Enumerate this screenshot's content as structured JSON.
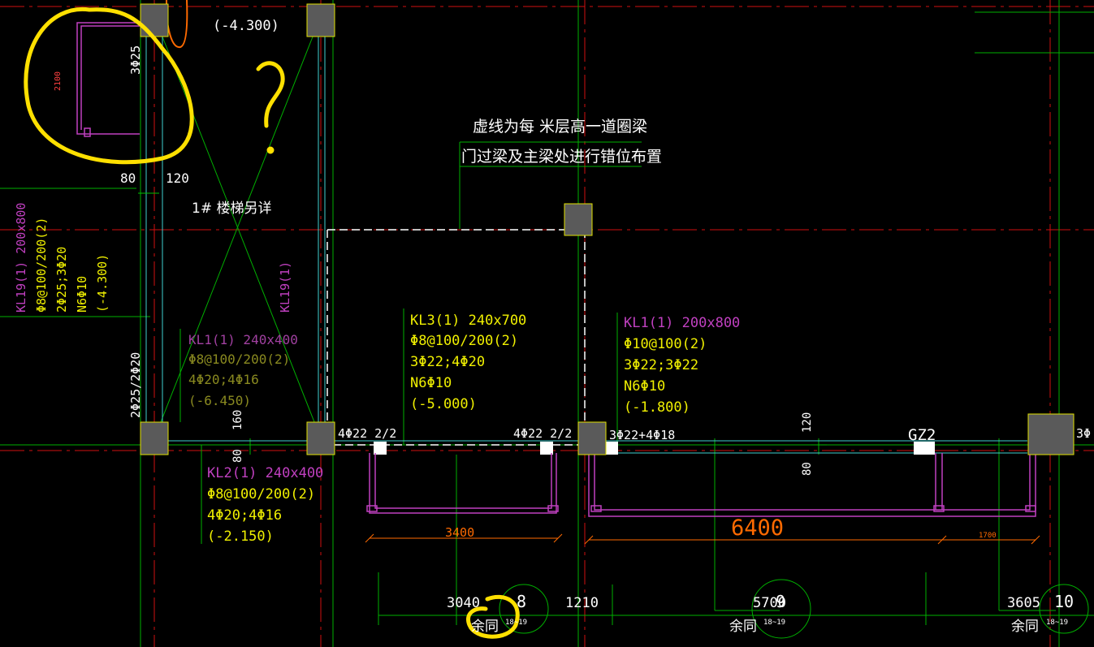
{
  "colors": {
    "background": "#000000",
    "axis_red": "#d01010",
    "green": "#00c000",
    "cyan": "#40d0d0",
    "white": "#ffffff",
    "yellow": "#f0f000",
    "magenta": "#c040c0",
    "olive": "#8a8a20",
    "orange": "#ff6a00",
    "highlight_yellow": "#ffe000",
    "column_fill": "#5a5a5a"
  },
  "top_labels": {
    "elevation_top": "(-4.300)",
    "rebar_3phi25": "3Φ25",
    "dim_2100": "2100",
    "dim_80_top": "80",
    "dim_120_top": "120",
    "question_mark": "?"
  },
  "notes": {
    "line1": "虚线为每  米层高一道圈梁",
    "line2": "门过梁及主梁处进行错位布置",
    "stair": "1# 楼梯另详"
  },
  "beams": {
    "kl19_left": [
      "KL19(1) 200x800",
      "Φ8@100/200(2)",
      "2Φ25;3Φ20",
      "N6Φ10",
      "(-4.300)"
    ],
    "kl19_mid": "KL19(1)",
    "rebar_2phi25": "2Φ25/2Φ20",
    "kl1_olive": [
      "KL1(1) 240x400",
      "Φ8@100/200(2)",
      "4Φ20;4Φ16",
      "(-6.450)"
    ],
    "kl3": [
      "KL3(1) 240x700",
      "Φ8@100/200(2)",
      "3Φ22;4Φ20",
      "N6Φ10",
      "(-5.000)"
    ],
    "kl1_right": [
      "KL1(1) 200x800",
      "Φ10@100(2)",
      "3Φ22;3Φ22",
      "N6Φ10",
      "(-1.800)"
    ],
    "kl2": [
      "KL2(1) 240x400",
      "Φ8@100/200(2)",
      "4Φ20;4Φ16",
      "(-2.150)"
    ]
  },
  "rebar_labels": {
    "a": "4Φ22 2/2",
    "b": "4Φ22 2/2",
    "c": "3Φ22+4Φ18",
    "d": "3Φ"
  },
  "dims": {
    "d160": "160",
    "d80_mid": "80",
    "d120_right": "120",
    "d80_right": "80",
    "gz2": "GZ2",
    "d3400": "3400",
    "d6400": "6400",
    "d1700": "1700"
  },
  "bottom": {
    "d3040": "3040",
    "d1210": "1210",
    "d5700": "5700",
    "d3605": "3605",
    "axis8": "8",
    "axis9": "9",
    "axis10": "10",
    "same": "余同",
    "sub": "18~19"
  }
}
